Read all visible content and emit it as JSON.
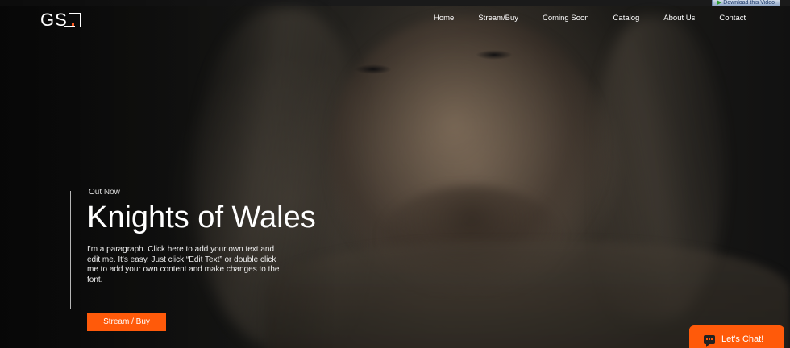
{
  "browser_overlay": {
    "download_label": "Download this Video"
  },
  "header": {
    "logo_text": "GS",
    "nav": [
      {
        "label": "Home"
      },
      {
        "label": "Stream/Buy"
      },
      {
        "label": "Coming Soon"
      },
      {
        "label": "Catalog"
      },
      {
        "label": "About Us"
      },
      {
        "label": "Contact"
      }
    ]
  },
  "hero": {
    "eyebrow": "Out Now",
    "title": "Knights of Wales",
    "paragraph": "I'm a paragraph. Click here to add your own text and edit me. It's easy. Just click “Edit Text” or double click me to add your own content and make changes to the font.",
    "cta_label": "Stream / Buy"
  },
  "chat": {
    "label": "Let's Chat!"
  },
  "colors": {
    "accent": "#ff5a0a",
    "text": "#ffffff",
    "background": "#111111"
  }
}
